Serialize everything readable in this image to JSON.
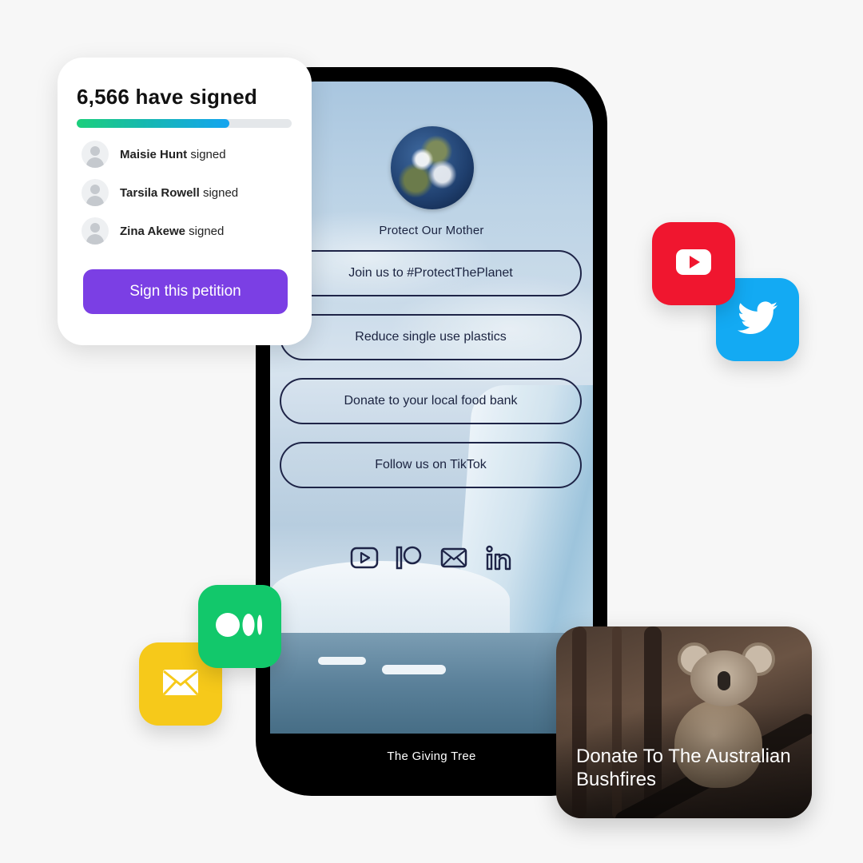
{
  "petition": {
    "title": "6,566 have signed",
    "progress": 0.71,
    "signers": [
      {
        "name": "Maisie Hunt",
        "action": "signed"
      },
      {
        "name": "Tarsila Rowell",
        "action": "signed"
      },
      {
        "name": "Zina Akewe",
        "action": "signed"
      }
    ],
    "button_label": "Sign this petition"
  },
  "profile": {
    "name": "Protect Our Mother",
    "links": [
      "Join us to #ProtectThePlanet",
      "Reduce single use plastics",
      "Donate to your local food bank",
      "Follow us on TikTok"
    ],
    "social_icons": [
      "youtube-icon",
      "patreon-icon",
      "email-icon",
      "linkedin-icon"
    ],
    "footer": "The Giving Tree"
  },
  "app_tiles": [
    "youtube-icon",
    "twitter-icon",
    "medium-icon",
    "email-icon"
  ],
  "donate_card": {
    "title": "Donate To The Australian Bushfires"
  },
  "colors": {
    "accent_purple": "#7b3fe4",
    "progress_green": "#1ccf7c",
    "progress_blue": "#14a4f0",
    "youtube_red": "#f0162f",
    "twitter_blue": "#13aaf3",
    "medium_green": "#12c86b",
    "email_yellow": "#f6c91a",
    "link_outline": "#1e2447"
  }
}
